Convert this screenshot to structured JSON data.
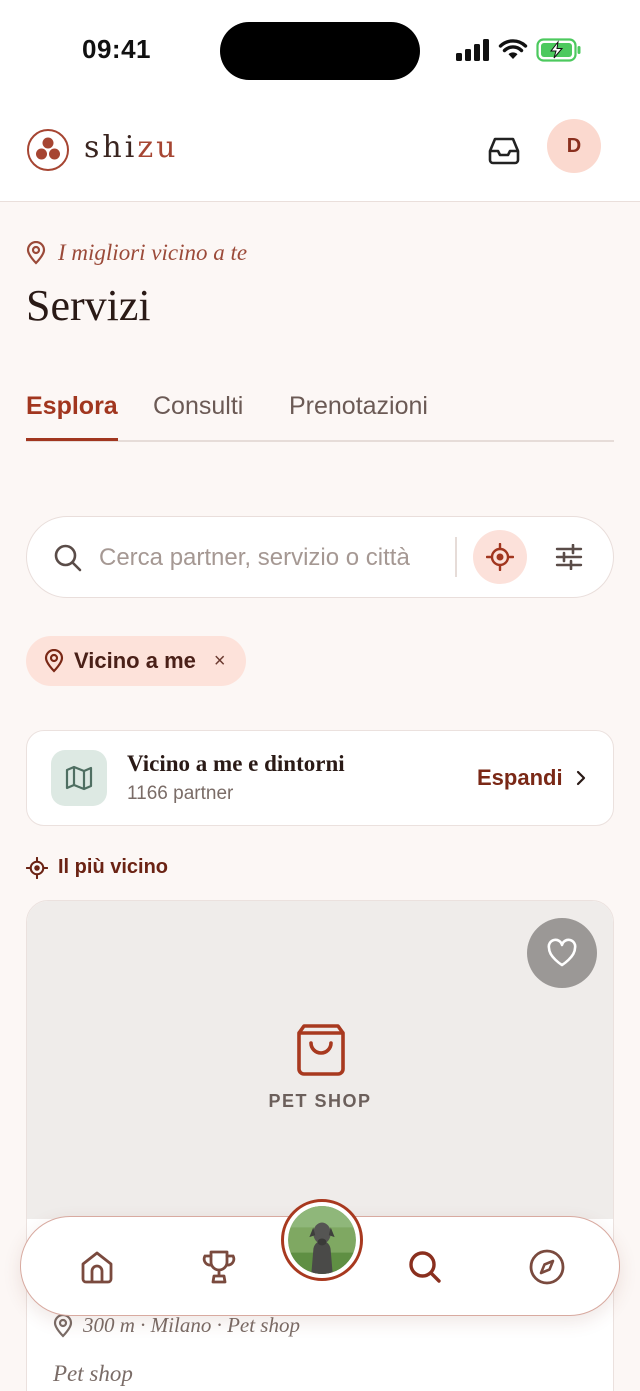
{
  "status_bar": {
    "time": "09:41"
  },
  "header": {
    "brand_prefix": "shi",
    "brand_accent": "zu",
    "avatar_initial": "D"
  },
  "page": {
    "subtitle": "I migliori vicino a te",
    "title": "Servizi"
  },
  "tabs": [
    {
      "label": "Esplora",
      "active": true
    },
    {
      "label": "Consulti",
      "active": false
    },
    {
      "label": "Prenotazioni",
      "active": false
    }
  ],
  "search": {
    "placeholder": "Cerca partner, servizio o città",
    "value": ""
  },
  "filter_chip": {
    "label": "Vicino a me",
    "close": "×"
  },
  "map_card": {
    "title": "Vicino a me e dintorni",
    "subtitle": "1166 partner",
    "action": "Espandi"
  },
  "section": {
    "label": "Il più vicino"
  },
  "partner": {
    "category": "PET SHOP",
    "meta": "300 m · Milano · Pet shop",
    "name": "Pet shop"
  },
  "colors": {
    "accent": "#a1361f",
    "chip_bg": "#fde2da",
    "map_icon_bg": "#dde9e3",
    "background": "#fcf7f5"
  },
  "icons": {
    "header": [
      "logo-icon",
      "inbox-icon"
    ],
    "nav": [
      "home-icon",
      "trophy-icon",
      "pet-avatar",
      "search-icon",
      "compass-icon"
    ]
  }
}
